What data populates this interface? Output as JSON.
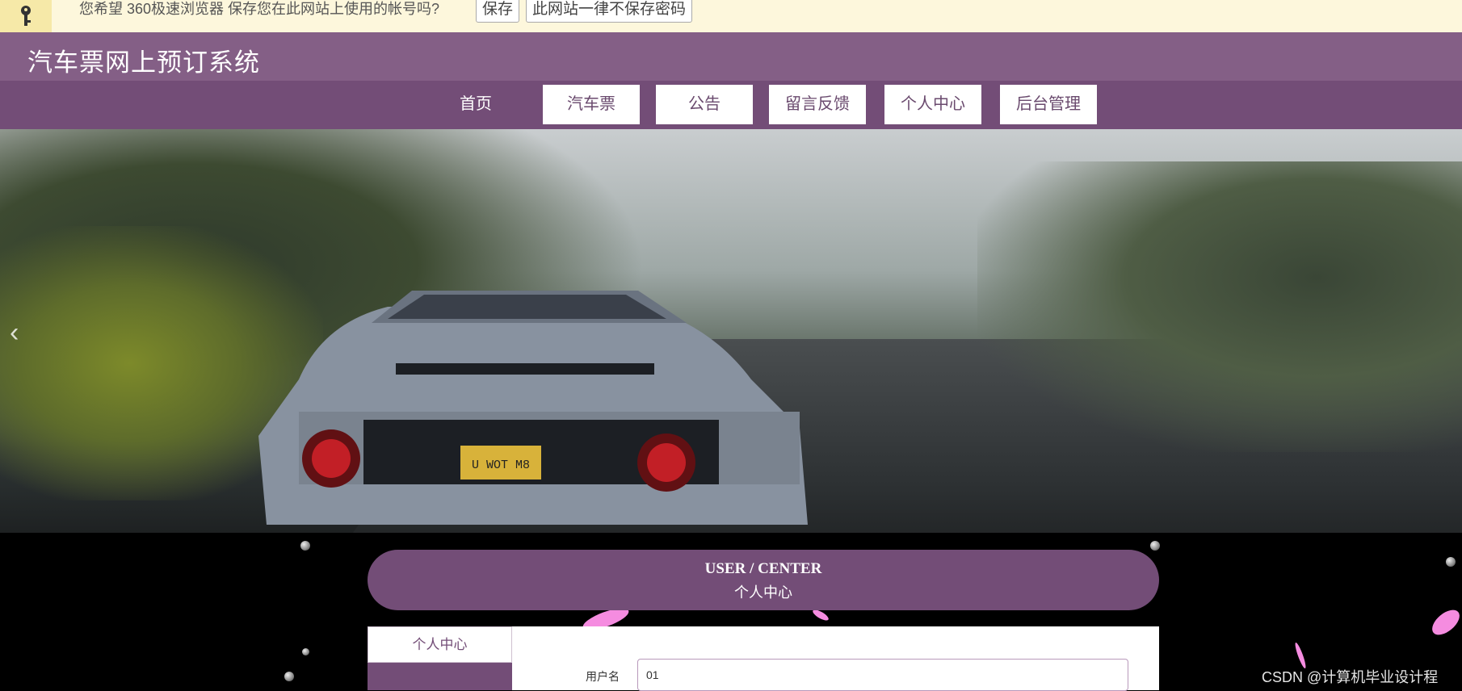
{
  "password_bar": {
    "message": "您希望 360极速浏览器 保存您在此网站上使用的帐号吗?",
    "save_label": "保存",
    "never_label": "此网站一律不保存密码",
    "icon": "key-icon"
  },
  "header": {
    "title": "汽车票网上预订系统"
  },
  "nav": {
    "items": [
      {
        "label": "首页",
        "active": true
      },
      {
        "label": "汽车票",
        "active": false
      },
      {
        "label": "公告",
        "active": false
      },
      {
        "label": "留言反馈",
        "active": false
      },
      {
        "label": "个人中心",
        "active": false
      },
      {
        "label": "后台管理",
        "active": false
      }
    ]
  },
  "banner": {
    "prev_arrow": "‹",
    "plate_text": "U WOT M8"
  },
  "user_center": {
    "title_en": "USER / CENTER",
    "title_cn": "个人中心",
    "sidebar_active": "个人中心",
    "username_label": "用户名",
    "username_value": "01"
  },
  "watermark": "CSDN @计算机毕业设计程",
  "colors": {
    "primary": "#734d77",
    "title_bar": "#845f86",
    "password_bar_bg": "#fdf7dc"
  }
}
